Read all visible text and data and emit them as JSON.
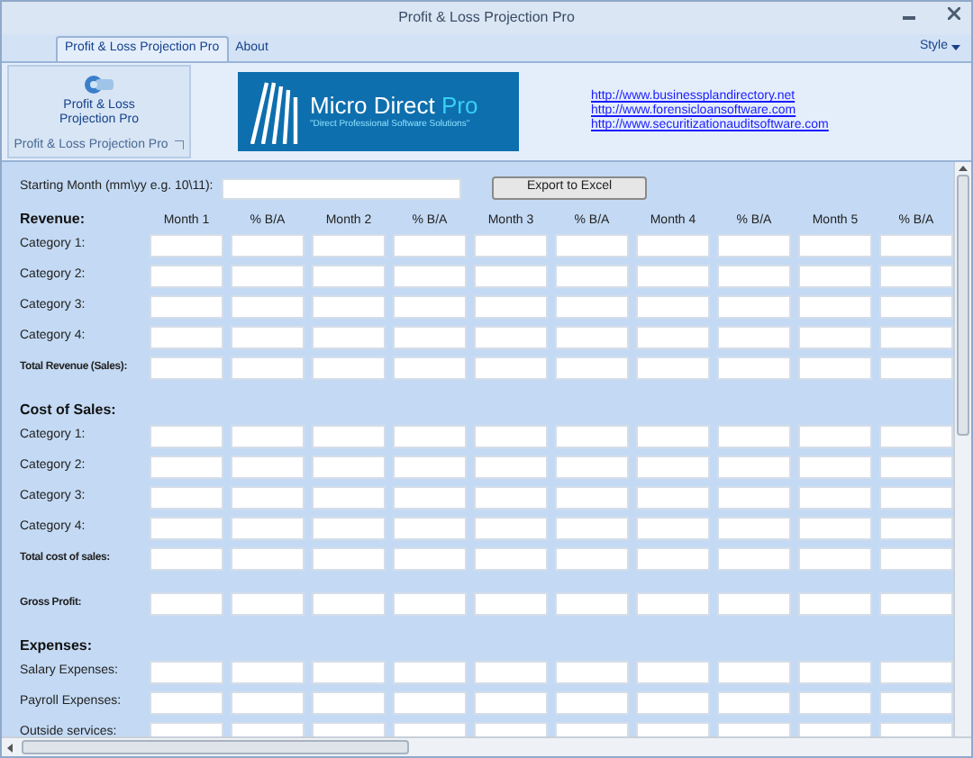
{
  "window": {
    "title": "Profit & Loss Projection Pro",
    "style_menu": "Style"
  },
  "tabs": [
    {
      "label": "Profit & Loss Projection Pro",
      "selected": true
    },
    {
      "label": "About",
      "selected": false
    }
  ],
  "ribbon": {
    "button": "Profit & Loss\nProjection Pro",
    "group": "Profit & Loss Projection Pro",
    "logo_title": "Micro Direct ",
    "logo_accent": "Pro",
    "logo_tagline": "\"Direct Professional Software Solutions\"",
    "links": [
      "http://www.businessplandirectory.net",
      "http://www.forensicloansoftware.com",
      "http://www.securitizationauditsoftware.com"
    ]
  },
  "start": {
    "label": "Starting Month (mm\\yy e.g. 10\\11):",
    "export": "Export to Excel"
  },
  "columns": [
    "Month 1",
    "% B/A",
    "Month 2",
    "% B/A",
    "Month 3",
    "% B/A",
    "Month 4",
    "% B/A",
    "Month 5",
    "% B/A"
  ],
  "sections": [
    {
      "title": "Revenue:",
      "rows": [
        {
          "label": "Category 1:",
          "kind": "line"
        },
        {
          "label": "Category 2:",
          "kind": "line"
        },
        {
          "label": "Category 3:",
          "kind": "line"
        },
        {
          "label": "Category 4:",
          "kind": "line"
        },
        {
          "label": "Total Revenue (Sales):",
          "kind": "total"
        }
      ]
    },
    {
      "title": "Cost of Sales:",
      "rows": [
        {
          "label": "Category 1:",
          "kind": "line"
        },
        {
          "label": "Category 2:",
          "kind": "line"
        },
        {
          "label": "Category 3:",
          "kind": "line"
        },
        {
          "label": "Category 4:",
          "kind": "line"
        },
        {
          "label": "Total cost of sales:",
          "kind": "total"
        },
        {
          "label": "Gross Profit:",
          "kind": "result"
        }
      ]
    },
    {
      "title": "Expenses:",
      "rows": [
        {
          "label": "Salary Expenses:",
          "kind": "line"
        },
        {
          "label": "Payroll Expenses:",
          "kind": "line"
        },
        {
          "label": "Outside services:",
          "kind": "line"
        }
      ]
    }
  ]
}
